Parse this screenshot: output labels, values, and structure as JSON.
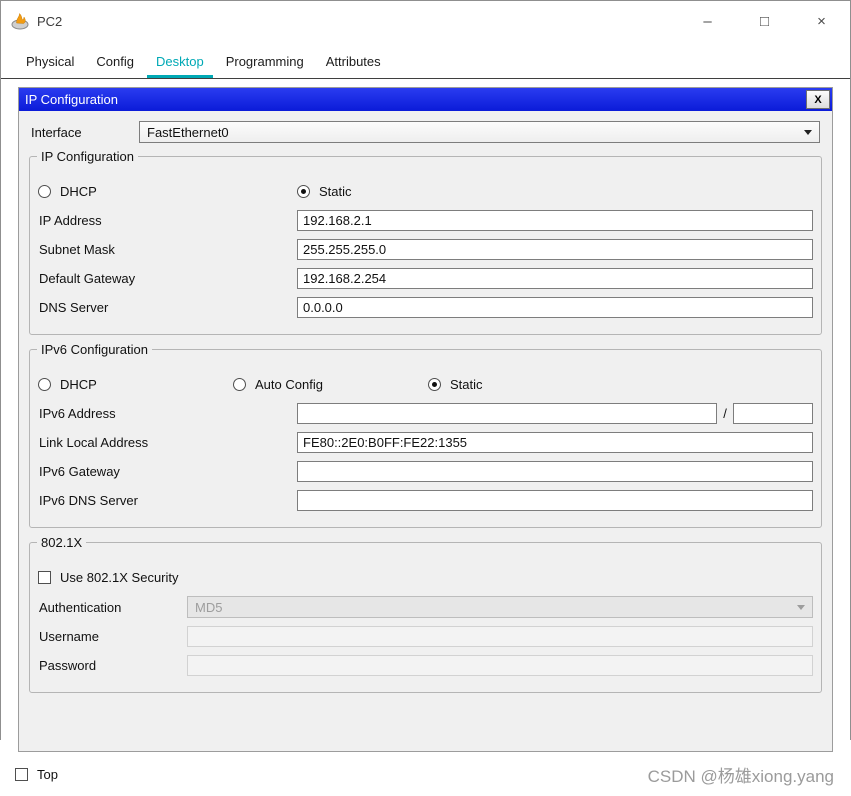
{
  "colors": {
    "tab_accent": "#00a9b5",
    "dialog_title_bg": "#0b1bd8",
    "watermark_gray": "#9b9b9b"
  },
  "window": {
    "title": "PC2",
    "minimize": "–",
    "maximize": "□",
    "close": "×"
  },
  "tabs": {
    "physical": "Physical",
    "config": "Config",
    "desktop": "Desktop",
    "programming": "Programming",
    "attributes": "Attributes",
    "active": "Desktop"
  },
  "dialog": {
    "title": "IP Configuration",
    "close": "X"
  },
  "interface": {
    "label": "Interface",
    "value": "FastEthernet0"
  },
  "ip": {
    "group_title": "IP Configuration",
    "dhcp": "DHCP",
    "static": "Static",
    "selected_mode": "Static",
    "rows": [
      {
        "label": "IP Address",
        "value": "192.168.2.1"
      },
      {
        "label": "Subnet Mask",
        "value": "255.255.255.0"
      },
      {
        "label": "Default Gateway",
        "value": "192.168.2.254"
      },
      {
        "label": "DNS Server",
        "value": "0.0.0.0"
      }
    ]
  },
  "ipv6": {
    "group_title": "IPv6 Configuration",
    "dhcp": "DHCP",
    "auto_config": "Auto Config",
    "static": "Static",
    "selected_mode": "Static",
    "address_label": "IPv6 Address",
    "address_value": "",
    "slash": "/",
    "prefix_value": "",
    "link_local_label": "Link Local Address",
    "link_local_value": "FE80::2E0:B0FF:FE22:1355",
    "gateway_label": "IPv6 Gateway",
    "gateway_value": "",
    "dns_label": "IPv6 DNS Server",
    "dns_value": ""
  },
  "dot1x": {
    "group_title": "802.1X",
    "use_label": "Use 802.1X Security",
    "use_checked": false,
    "auth_label": "Authentication",
    "auth_value": "MD5",
    "username_label": "Username",
    "username_value": "",
    "password_label": "Password",
    "password_value": ""
  },
  "footer": {
    "top_label": "Top",
    "top_checked": false,
    "watermark": "CSDN @杨雄xiong.yang"
  }
}
